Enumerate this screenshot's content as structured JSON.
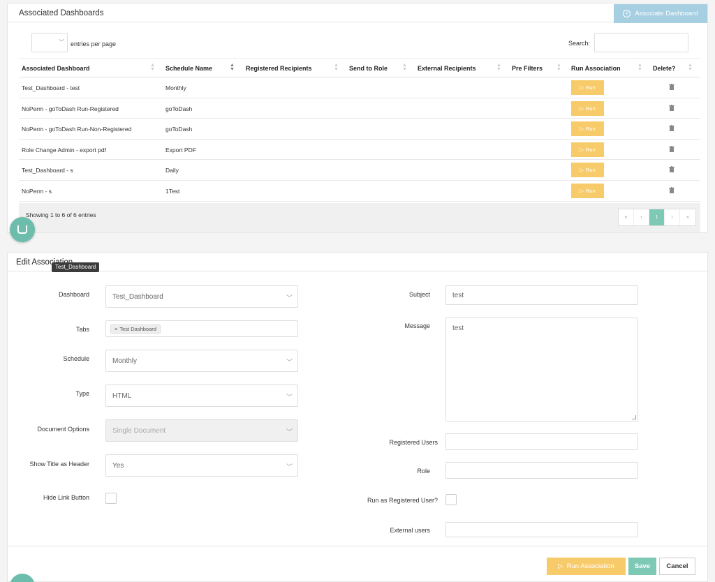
{
  "associated": {
    "title": "Associated Dashboards",
    "associate_button": "Associate Dashboard",
    "entries_value": "",
    "entries_label": "entries per page",
    "search_label": "Search:",
    "search_value": "",
    "columns": [
      "Associated Dashboard",
      "Schedule Name",
      "Registered Recipients",
      "Send to Role",
      "External Recipients",
      "Pre Filters",
      "Run Association",
      "Delete?"
    ],
    "run_label": "Run",
    "rows": [
      {
        "dashboard": "Test_Dashboard - test",
        "schedule": "Monthly"
      },
      {
        "dashboard": "NoPerm - goToDash Run-Registered",
        "schedule": "goToDash"
      },
      {
        "dashboard": "NoPerm - goToDash Run-Non-Registered",
        "schedule": "goToDash"
      },
      {
        "dashboard": "Role Change Admin - export pdf",
        "schedule": "Export PDF"
      },
      {
        "dashboard": "Test_Dashboard - s",
        "schedule": "Daily"
      },
      {
        "dashboard": "NoPerm - s",
        "schedule": "1Test"
      }
    ],
    "showing": "Showing 1 to 6 of 6 entries",
    "pager": {
      "first": "«",
      "prev": "‹",
      "page": "1",
      "next": "›",
      "last": "»"
    }
  },
  "edit": {
    "title": "Edit Association",
    "tooltip": "Test_Dashboard",
    "labels": {
      "dashboard": "Dashboard",
      "tabs": "Tabs",
      "schedule": "Schedule",
      "type": "Type",
      "document_options": "Document Options",
      "show_title": "Show Title as Header",
      "hide_link": "Hide Link Button",
      "subject": "Subject",
      "message": "Message",
      "registered_users": "Registered Users",
      "role": "Role",
      "run_as_registered": "Run as Registered User?",
      "external_users": "External users"
    },
    "values": {
      "dashboard": "Test_Dashboard",
      "tab_tag": "Test Dashboard",
      "schedule": "Monthly",
      "type": "HTML",
      "document_options": "Single Document",
      "show_title": "Yes",
      "subject": "test",
      "message": "test",
      "registered_users": "",
      "role": "",
      "external_users": ""
    },
    "hide_link_checked": false,
    "run_as_registered_checked": false,
    "buttons": {
      "run": "Run Association",
      "save": "Save",
      "cancel": "Cancel"
    }
  },
  "colors": {
    "accent_blue": "#a6cfe2",
    "run_yellow": "#f8cb6a",
    "save_green": "#7ec8b6"
  }
}
